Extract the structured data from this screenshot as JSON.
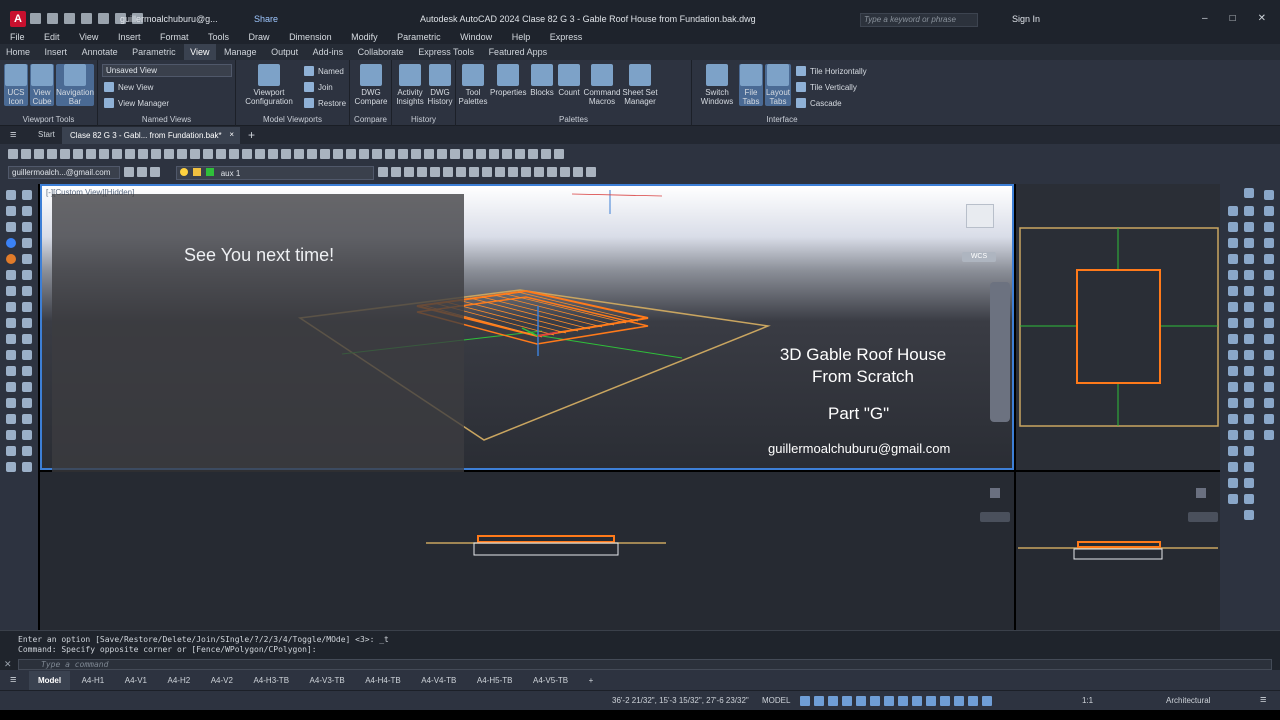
{
  "app": {
    "logo": "A",
    "account": "guillermoalchuburu@g...",
    "share": "Share",
    "window_title": "Autodesk AutoCAD 2024   Clase 82 G 3 - Gable Roof House from Fundation.bak.dwg",
    "search_placeholder": "Type a keyword or phrase",
    "sign_in": "Sign In",
    "win_controls": [
      "–",
      "□",
      "✕"
    ]
  },
  "menu": [
    "File",
    "Edit",
    "View",
    "Insert",
    "Format",
    "Tools",
    "Draw",
    "Dimension",
    "Modify",
    "Parametric",
    "Window",
    "Help",
    "Express"
  ],
  "ribbon_tabs": [
    "Home",
    "Insert",
    "Annotate",
    "Parametric",
    "View",
    "Manage",
    "Output",
    "Add-ins",
    "Collaborate",
    "Express Tools",
    "Featured Apps"
  ],
  "ribbon_active_tab": "View",
  "ribbon": {
    "viewport_tools": {
      "label": "Viewport Tools",
      "buttons": [
        "UCS Icon",
        "View Cube",
        "Navigation Bar"
      ]
    },
    "named_views": {
      "label": "Named Views",
      "dropdown": "Unsaved View",
      "items": [
        "New View",
        "View Manager"
      ]
    },
    "model_viewports": {
      "label": "Model Viewports",
      "big": "Viewport Configuration",
      "items": [
        "Named",
        "Join",
        "Restore"
      ]
    },
    "compare": {
      "label": "Compare",
      "button": "DWG Compare"
    },
    "history": {
      "label": "History",
      "buttons": [
        "Activity Insights",
        "DWG History"
      ]
    },
    "palettes": {
      "label": "Palettes",
      "buttons": [
        "Tool Palettes",
        "Properties",
        "Blocks",
        "Count",
        "Command Macros",
        "Sheet Set Manager"
      ]
    },
    "interface": {
      "label": "Interface",
      "buttons": [
        "Switch Windows",
        "File Tabs",
        "Layout Tabs"
      ],
      "items": [
        "Tile Horizontally",
        "Tile Vertically",
        "Cascade"
      ]
    }
  },
  "file_tabs": {
    "start": "Start",
    "active": "Clase 82 G 3 - Gabl... from Fundation.bak*",
    "close": "×",
    "add": "+"
  },
  "toolbar": {
    "workspace": "guillermoalch...@gmail.com",
    "layer": "aux 1"
  },
  "viewport": {
    "label": "[-][Custom View][Hidden]",
    "wcs": "WCS",
    "overlay_text": "See You next time!",
    "title_line1": "3D Gable Roof House",
    "title_line2": "From Scratch",
    "part": "Part \"G\"",
    "email": "guillermoalchuburu@gmail.com"
  },
  "command": {
    "line1": "Enter an option [Save/Restore/Delete/Join/SIngle/?/2/3/4/Toggle/MOde] <3>: _t",
    "line2": "Command: Specify opposite corner or [Fence/WPolygon/CPolygon]:",
    "placeholder": "Type a command"
  },
  "layouts": [
    "Model",
    "A4-H1",
    "A4-V1",
    "A4-H2",
    "A4-V2",
    "A4-H3-TB",
    "A4-V3-TB",
    "A4-H4-TB",
    "A4-V4-TB",
    "A4-H5-TB",
    "A4-V5-TB",
    "+"
  ],
  "status": {
    "coords": "36'-2 21/32\", 15'-3 15/32\", 27'-6 23/32\"",
    "model": "MODEL",
    "scale": "1:1",
    "units": "Architectural"
  },
  "colors": {
    "accent": "#3d7fd6",
    "roof": "#ff7a1a",
    "grid_green": "#2fbf3a"
  }
}
